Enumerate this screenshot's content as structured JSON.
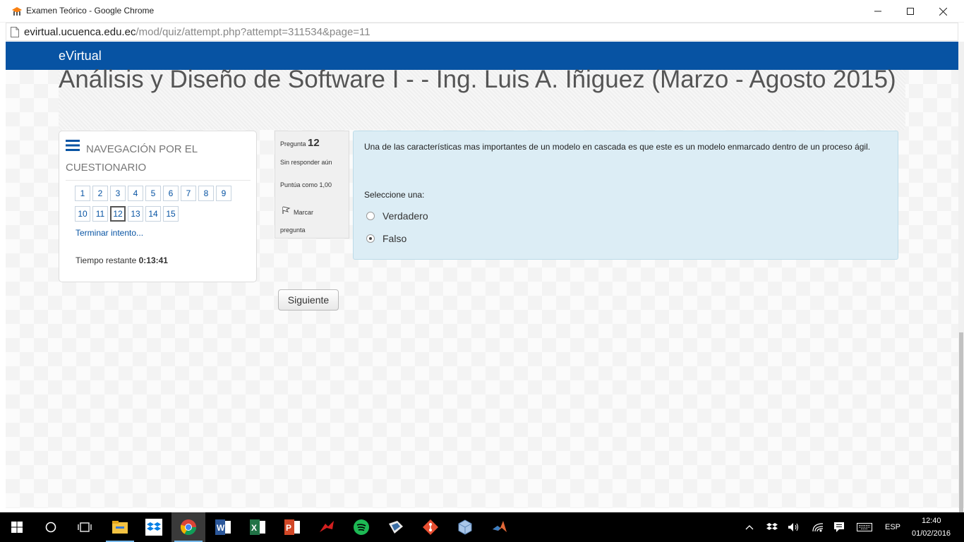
{
  "window": {
    "title": "Examen Teórico - Google Chrome",
    "url_host": "evirtual.ucuenca.edu.ec",
    "url_path": "/mod/quiz/attempt.php?attempt=311534&page=11"
  },
  "site": {
    "brand": "eVirtual",
    "course_title": "Análisis y Diseño de Software I - - Ing. Luis A. Iñiguez (Marzo - Agosto 2015)"
  },
  "quiz_nav": {
    "title": "NAVEGACIÓN POR EL CUESTIONARIO",
    "questions": [
      "1",
      "2",
      "3",
      "4",
      "5",
      "6",
      "7",
      "8",
      "9",
      "10",
      "11",
      "12",
      "13",
      "14",
      "15"
    ],
    "current": "12",
    "finish_link": "Terminar intento...",
    "time_label": "Tiempo restante",
    "time_value": "0:13:41"
  },
  "question": {
    "label": "Pregunta",
    "number": "12",
    "state": "Sin responder aún",
    "grade": "Puntúa como 1,00",
    "flag_label": "Marcar pregunta",
    "text": "Una de las características mas importantes de un modelo en cascada es que este es un modelo enmarcado dentro de un proceso ágil.",
    "prompt": "Seleccione una:",
    "options": [
      {
        "label": "Verdadero",
        "selected": false
      },
      {
        "label": "Falso",
        "selected": true
      }
    ],
    "next_button": "Siguiente"
  },
  "taskbar": {
    "apps": [
      "start-icon",
      "cortana-icon",
      "task-view-icon",
      "file-explorer-icon",
      "dropbox-icon",
      "chrome-icon",
      "word-icon",
      "excel-icon",
      "powerpoint-icon",
      "app-red-icon",
      "spotify-icon",
      "app-flag-icon",
      "git-icon",
      "virtualbox-icon",
      "matlab-icon"
    ],
    "language": "ESP",
    "time": "12:40",
    "date": "01/02/2016"
  },
  "colors": {
    "brand_blue": "#0753a3",
    "question_bg": "#dcedf5"
  }
}
